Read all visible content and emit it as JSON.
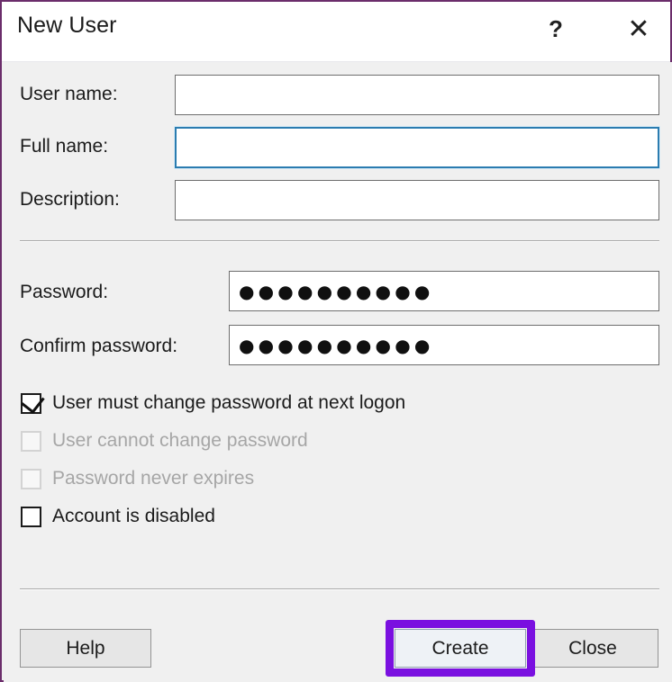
{
  "window": {
    "title": "New User",
    "border_color": "#6b2d6b",
    "background": "#f0f0f0",
    "titlebar_background": "#ffffff"
  },
  "titlebar": {
    "help_icon": "?",
    "close_icon": "✕"
  },
  "form": {
    "fields": [
      {
        "label": "User name:",
        "value": "",
        "placeholder": "",
        "focused": false,
        "masked": false
      },
      {
        "label": "Full name:",
        "value": "",
        "placeholder": "",
        "focused": true,
        "masked": false
      },
      {
        "label": "Description:",
        "value": "",
        "placeholder": "",
        "focused": false,
        "masked": false
      }
    ],
    "password_fields": [
      {
        "label": "Password:",
        "value": "●●●●●●●●●●",
        "dot_count": 10,
        "masked": true
      },
      {
        "label": "Confirm password:",
        "value": "●●●●●●●●●●",
        "dot_count": 10,
        "masked": true
      }
    ],
    "checkboxes": [
      {
        "label": "User must change password at next logon",
        "checked": true,
        "disabled": false
      },
      {
        "label": "User cannot change password",
        "checked": false,
        "disabled": true
      },
      {
        "label": "Password never expires",
        "checked": false,
        "disabled": true
      },
      {
        "label": "Account is disabled",
        "checked": false,
        "disabled": false
      }
    ]
  },
  "buttons": {
    "help": "Help",
    "create": "Create",
    "close": "Close"
  },
  "annotation": {
    "target": "Create",
    "color": "#7a10e0"
  },
  "colors": {
    "focus_border": "#2b7cb0",
    "window_border": "#6b2d6b",
    "highlight": "#7a10e0",
    "disabled_text": "#a6a6a6"
  }
}
